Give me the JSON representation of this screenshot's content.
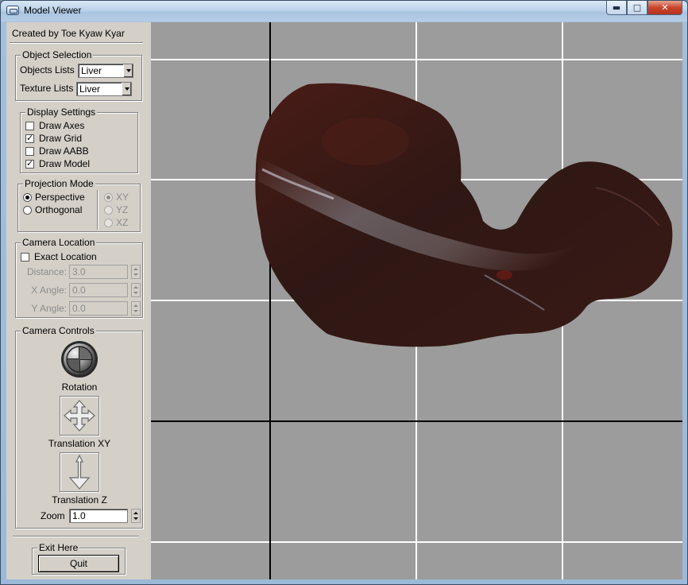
{
  "window": {
    "title": "Model Viewer"
  },
  "panel": {
    "credit": "Created by Toe Kyaw Kyar",
    "object_selection": {
      "title": "Object Selection",
      "objects_label": "Objects Lists",
      "objects_value": "Liver",
      "texture_label": "Texture Lists",
      "texture_value": "Liver"
    },
    "display_settings": {
      "title": "Display Settings",
      "items": [
        {
          "label": "Draw Axes",
          "checked": false
        },
        {
          "label": "Draw Grid",
          "checked": true
        },
        {
          "label": "Draw AABB",
          "checked": false
        },
        {
          "label": "Draw Model",
          "checked": true
        }
      ]
    },
    "projection_mode": {
      "title": "Projection Mode",
      "modes": [
        {
          "label": "Perspective",
          "selected": true
        },
        {
          "label": "Orthogonal",
          "selected": false
        }
      ],
      "planes": [
        {
          "label": "XY",
          "selected": true
        },
        {
          "label": "YZ",
          "selected": false
        },
        {
          "label": "XZ",
          "selected": false
        }
      ]
    },
    "camera_location": {
      "title": "Camera Location",
      "exact_label": "Exact Location",
      "exact_checked": false,
      "fields": [
        {
          "label": "Distance:",
          "value": "3.0"
        },
        {
          "label": "X Angle:",
          "value": "0.0"
        },
        {
          "label": "Y Angle:",
          "value": "0.0"
        }
      ]
    },
    "camera_controls": {
      "title": "Camera Controls",
      "rotation_label": "Rotation",
      "translation_xy_label": "Translation XY",
      "translation_z_label": "Translation Z",
      "zoom_label": "Zoom",
      "zoom_value": "1.0"
    },
    "exit": {
      "title": "Exit Here",
      "quit_label": "Quit"
    }
  },
  "viewport": {
    "background": "#9c9c9c",
    "grid_color": "#ffffff",
    "axis_color": "#000000",
    "model": "liver-model"
  }
}
